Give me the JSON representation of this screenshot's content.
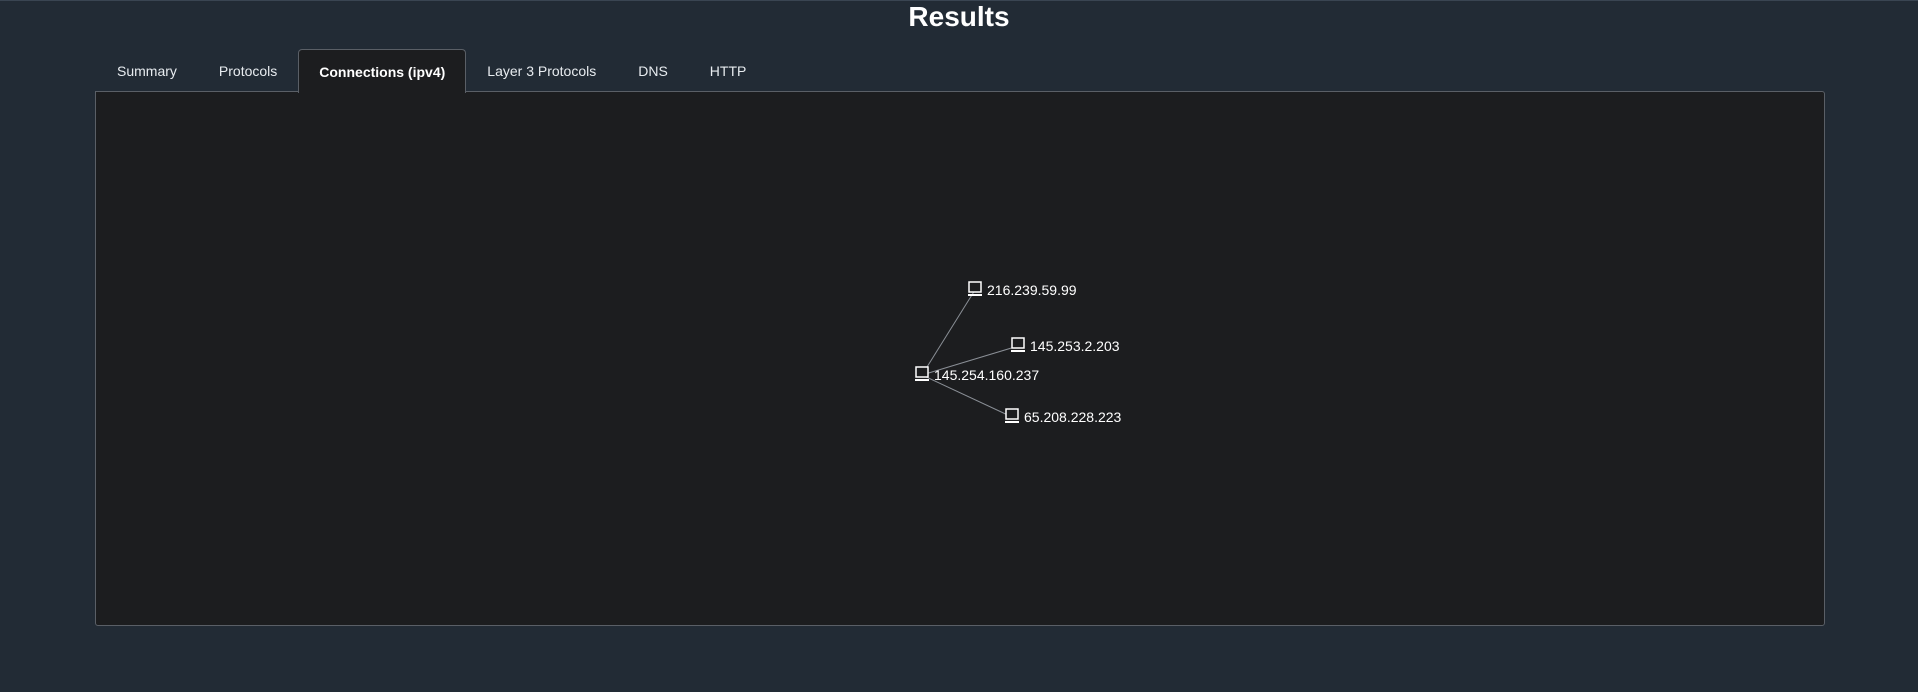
{
  "page": {
    "title": "Results"
  },
  "tabs": [
    {
      "label": "Summary",
      "active": false
    },
    {
      "label": "Protocols",
      "active": false
    },
    {
      "label": "Connections (ipv4)",
      "active": true
    },
    {
      "label": "Layer 3 Protocols",
      "active": false
    },
    {
      "label": "DNS",
      "active": false
    },
    {
      "label": "HTTP",
      "active": false
    }
  ],
  "graph": {
    "nodes": [
      {
        "id": "n0",
        "label": "145.254.160.237",
        "icon": "computer-icon"
      },
      {
        "id": "n1",
        "label": "216.239.59.99",
        "icon": "computer-icon"
      },
      {
        "id": "n2",
        "label": "145.253.2.203",
        "icon": "computer-icon"
      },
      {
        "id": "n3",
        "label": "65.208.228.223",
        "icon": "computer-icon"
      }
    ],
    "edges": [
      {
        "from": "n0",
        "to": "n1"
      },
      {
        "from": "n0",
        "to": "n2"
      },
      {
        "from": "n0",
        "to": "n3"
      }
    ]
  },
  "colors": {
    "background": "#222b35",
    "panel": "#1c1d1f",
    "border": "#5a5f66",
    "edge": "#8a8f96",
    "text": "#ffffff"
  }
}
